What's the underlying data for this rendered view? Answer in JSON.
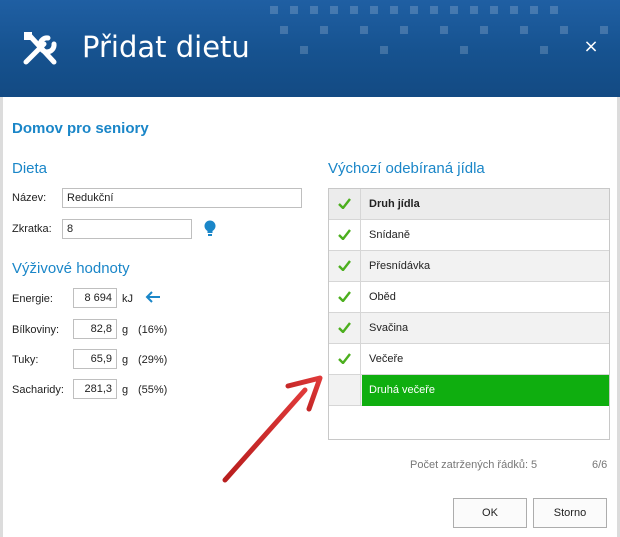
{
  "window": {
    "title": "Přidat dietu",
    "close_glyph": "×",
    "accent_color": "#1a86c8",
    "header_color": "#16528f"
  },
  "org_name": "Domov pro seniory",
  "diet": {
    "section_title": "Dieta",
    "name_label": "Název:",
    "name_value": "Redukční",
    "short_label": "Zkratka:",
    "short_value": "8",
    "hint_icon": "lightbulb-icon"
  },
  "nutrition": {
    "section_title": "Výživové hodnoty",
    "rows": [
      {
        "label": "Energie:",
        "value": "8 694",
        "unit": "kJ",
        "pct": ""
      },
      {
        "label": "Bílkoviny:",
        "value": "82,8",
        "unit": "g",
        "pct": "(16%)"
      },
      {
        "label": "Tuky:",
        "value": "65,9",
        "unit": "g",
        "pct": "(29%)"
      },
      {
        "label": "Sacharidy:",
        "value": "281,3",
        "unit": "g",
        "pct": "(55%)"
      }
    ],
    "energy_icon": "arrow-left-icon"
  },
  "meals": {
    "section_title": "Výchozí odebíraná jídla",
    "header": "Druh jídla",
    "rows": [
      {
        "label": "Snídaně",
        "checked": true
      },
      {
        "label": "Přesnídávka",
        "checked": true
      },
      {
        "label": "Oběd",
        "checked": true
      },
      {
        "label": "Svačina",
        "checked": true
      },
      {
        "label": "Večeře",
        "checked": true
      },
      {
        "label": "Druhá večeře",
        "checked": false,
        "selected": true
      }
    ],
    "selected_color": "#0fae0f",
    "check_color": "#4caf1e",
    "count_text": "Počet zatržených řádků: 5",
    "page_text": "6/6"
  },
  "buttons": {
    "ok": "OK",
    "cancel": "Storno"
  },
  "annotation_arrow_color": "#d42a2a"
}
